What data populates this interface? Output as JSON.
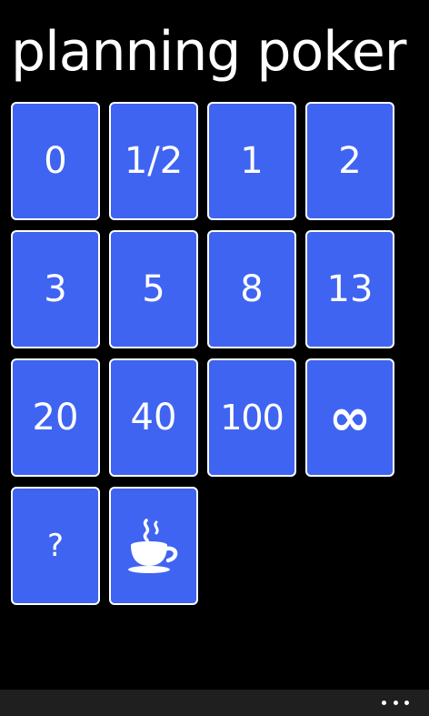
{
  "app": {
    "title": "planning poker"
  },
  "cards": [
    {
      "label": "0"
    },
    {
      "label": "1/2"
    },
    {
      "label": "1"
    },
    {
      "label": "2"
    },
    {
      "label": "3"
    },
    {
      "label": "5"
    },
    {
      "label": "8"
    },
    {
      "label": "13"
    },
    {
      "label": "20"
    },
    {
      "label": "40"
    },
    {
      "label": "100"
    },
    {
      "label": "∞"
    },
    {
      "label": "?"
    },
    {
      "icon": "coffee-cup-icon"
    }
  ],
  "appbar": {
    "more_icon": "ellipsis-icon"
  },
  "colors": {
    "background": "#000000",
    "card": "#3f64f1",
    "card_border": "#ffffff",
    "text": "#ffffff",
    "appbar": "#1f1f1f"
  }
}
